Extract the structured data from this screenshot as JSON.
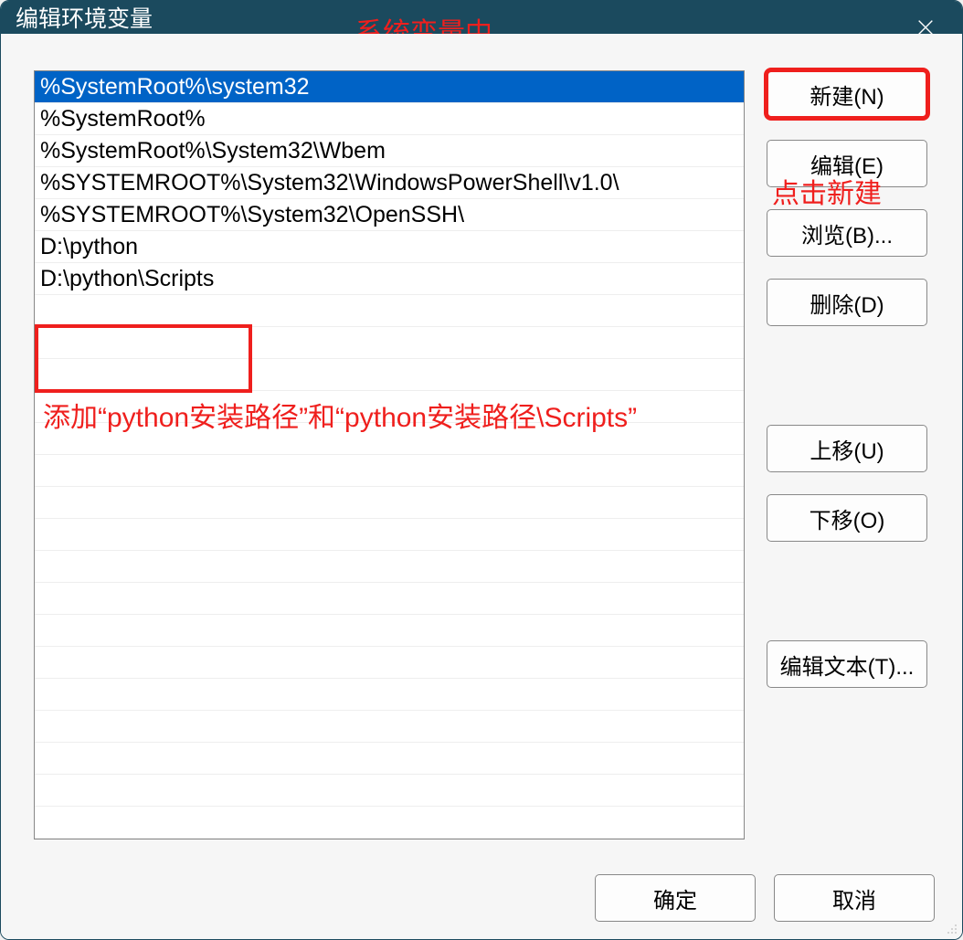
{
  "window": {
    "title": "编辑环境变量"
  },
  "annotations": {
    "top": "系统变量中",
    "click_new": "点击新建",
    "add_path": "添加“python安装路径”和“python安装路径\\Scripts”"
  },
  "path_list": [
    {
      "value": "%SystemRoot%\\system32",
      "selected": true
    },
    {
      "value": "%SystemRoot%",
      "selected": false
    },
    {
      "value": "%SystemRoot%\\System32\\Wbem",
      "selected": false
    },
    {
      "value": "%SYSTEMROOT%\\System32\\WindowsPowerShell\\v1.0\\",
      "selected": false
    },
    {
      "value": "%SYSTEMROOT%\\System32\\OpenSSH\\",
      "selected": false
    },
    {
      "value": "D:\\python",
      "selected": false
    },
    {
      "value": "D:\\python\\Scripts",
      "selected": false
    }
  ],
  "buttons": {
    "new": "新建(N)",
    "edit": "编辑(E)",
    "browse": "浏览(B)...",
    "delete": "删除(D)",
    "move_up": "上移(U)",
    "move_down": "下移(O)",
    "edit_text": "编辑文本(T)...",
    "ok": "确定",
    "cancel": "取消"
  }
}
